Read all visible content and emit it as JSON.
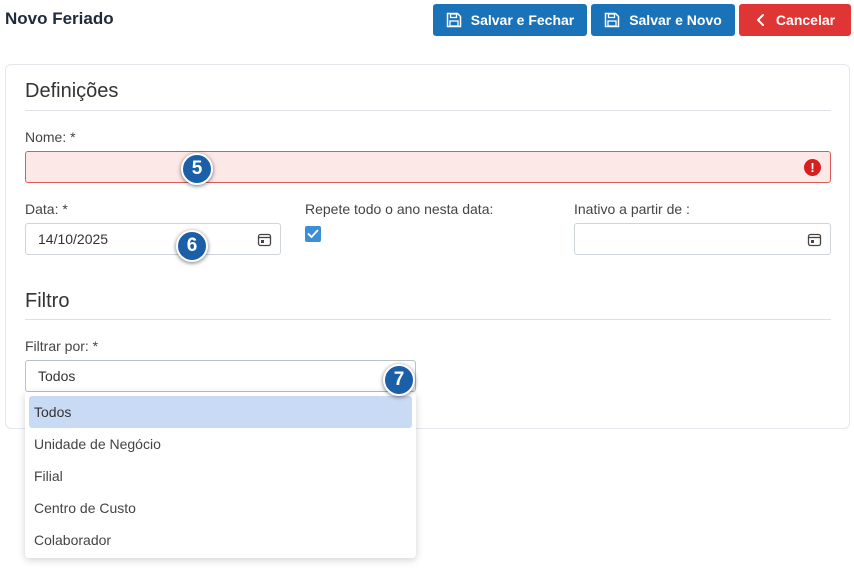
{
  "header": {
    "title": "Novo Feriado",
    "save_close_label": "Salvar e Fechar",
    "save_new_label": "Salvar e Novo",
    "cancel_label": "Cancelar"
  },
  "sections": {
    "definitions_title": "Definições",
    "filter_title": "Filtro"
  },
  "form": {
    "name_label": "Nome: *",
    "name_value": "",
    "name_error_icon": "!",
    "date_label": "Data: *",
    "date_value": "14/10/2025",
    "repeat_label": "Repete todo o ano nesta data:",
    "repeat_checked": true,
    "inactive_label": "Inativo a partir de :",
    "inactive_value": "",
    "filter_label": "Filtrar por: *",
    "filter_value": "Todos"
  },
  "dropdown": {
    "options": [
      "Todos",
      "Unidade de Negócio",
      "Filial",
      "Centro de Custo",
      "Colaborador"
    ],
    "selected": "Todos"
  },
  "badges": [
    "5",
    "6",
    "7"
  ],
  "colors": {
    "primary": "#1a73b8",
    "danger": "#e03535",
    "error_bg": "#fde8e8",
    "error_border": "#e05a5a",
    "badge": "#1a5fa8",
    "selected_option": "#c9daf5"
  }
}
